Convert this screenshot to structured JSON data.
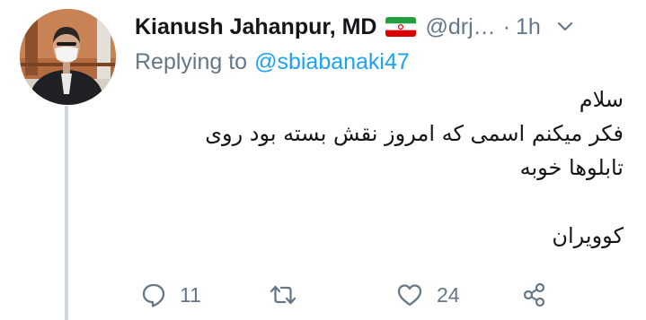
{
  "tweet": {
    "display_name": "Kianush Jahanpur, MD",
    "handle": "@drj…",
    "separator": "·",
    "time": "1h",
    "replying_label": "Replying to",
    "replying_to": "@sbiabanaki47",
    "text_lines": [
      "سلام",
      "فکر میکنم اسمی که امروز نقش بسته بود روی",
      "تابلوها خوبه",
      "",
      "کوویران"
    ]
  },
  "actions": {
    "reply_count": "11",
    "retweet_count": "",
    "like_count": "24"
  },
  "icons": {
    "avatar": "profile-photo",
    "flag": "iran-flag-icon",
    "menu": "chevron-down-icon",
    "reply": "speech-bubble-icon",
    "retweet": "retweet-arrows-icon",
    "like": "heart-icon",
    "share": "share-nodes-icon"
  },
  "colors": {
    "text_primary": "#14171a",
    "text_secondary": "#657786",
    "link": "#1da1f2",
    "thread_line": "#ccd6dd"
  }
}
